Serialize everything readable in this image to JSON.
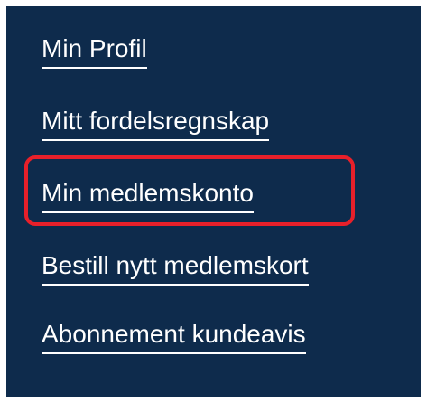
{
  "menu": {
    "items": [
      {
        "label": "Min Profil"
      },
      {
        "label": "Mitt fordelsregnskap"
      },
      {
        "label": "Min medlemskonto"
      },
      {
        "label": "Bestill nytt medlemskort"
      },
      {
        "label": "Abonnement kundeavis"
      }
    ],
    "highlighted_item": "Min medlemskonto"
  },
  "colors": {
    "background": "#0e2b4c",
    "text": "#ffffff",
    "highlight": "#e8202a"
  }
}
